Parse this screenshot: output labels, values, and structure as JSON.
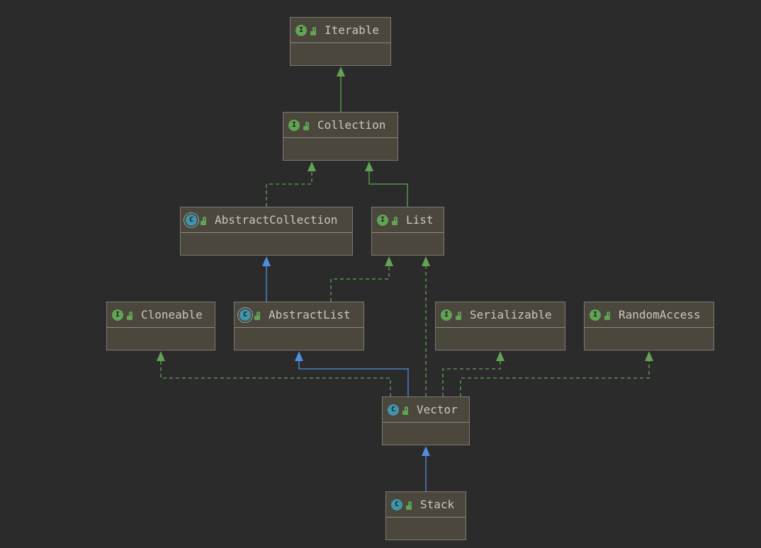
{
  "nodes": {
    "iterable": {
      "name": "Iterable",
      "kind": "interface",
      "badge": "I"
    },
    "collection": {
      "name": "Collection",
      "kind": "interface",
      "badge": "I"
    },
    "abstract_collection": {
      "name": "AbstractCollection",
      "kind": "abstract-class",
      "badge": "C"
    },
    "list": {
      "name": "List",
      "kind": "interface",
      "badge": "I"
    },
    "cloneable": {
      "name": "Cloneable",
      "kind": "interface",
      "badge": "I"
    },
    "abstract_list": {
      "name": "AbstractList",
      "kind": "abstract-class",
      "badge": "C"
    },
    "serializable": {
      "name": "Serializable",
      "kind": "interface",
      "badge": "I"
    },
    "random_access": {
      "name": "RandomAccess",
      "kind": "interface",
      "badge": "I"
    },
    "vector": {
      "name": "Vector",
      "kind": "class",
      "badge": "C"
    },
    "stack": {
      "name": "Stack",
      "kind": "class",
      "badge": "C"
    }
  },
  "edges": [
    {
      "from": "collection",
      "to": "iterable",
      "type": "extends"
    },
    {
      "from": "abstract_collection",
      "to": "collection",
      "type": "implements"
    },
    {
      "from": "list",
      "to": "collection",
      "type": "extends"
    },
    {
      "from": "abstract_list",
      "to": "abstract_collection",
      "type": "extends"
    },
    {
      "from": "abstract_list",
      "to": "list",
      "type": "implements"
    },
    {
      "from": "vector",
      "to": "cloneable",
      "type": "implements"
    },
    {
      "from": "vector",
      "to": "abstract_list",
      "type": "extends"
    },
    {
      "from": "vector",
      "to": "list",
      "type": "implements"
    },
    {
      "from": "vector",
      "to": "serializable",
      "type": "implements"
    },
    {
      "from": "vector",
      "to": "random_access",
      "type": "implements"
    },
    {
      "from": "stack",
      "to": "vector",
      "type": "extends"
    }
  ],
  "colors": {
    "background": "#2b2b2b",
    "node_fill": "#4b473d",
    "node_border": "#7a7a72",
    "interface_badge": "#62a356",
    "class_badge": "#3f95ac",
    "interface_edge": "#62a356",
    "class_edge": "#4f8fe0",
    "label_text": "#c9c7bd"
  },
  "icons": {
    "interface": "interface-badge-icon",
    "class": "class-badge-icon",
    "visibility": "public-lock-icon"
  }
}
